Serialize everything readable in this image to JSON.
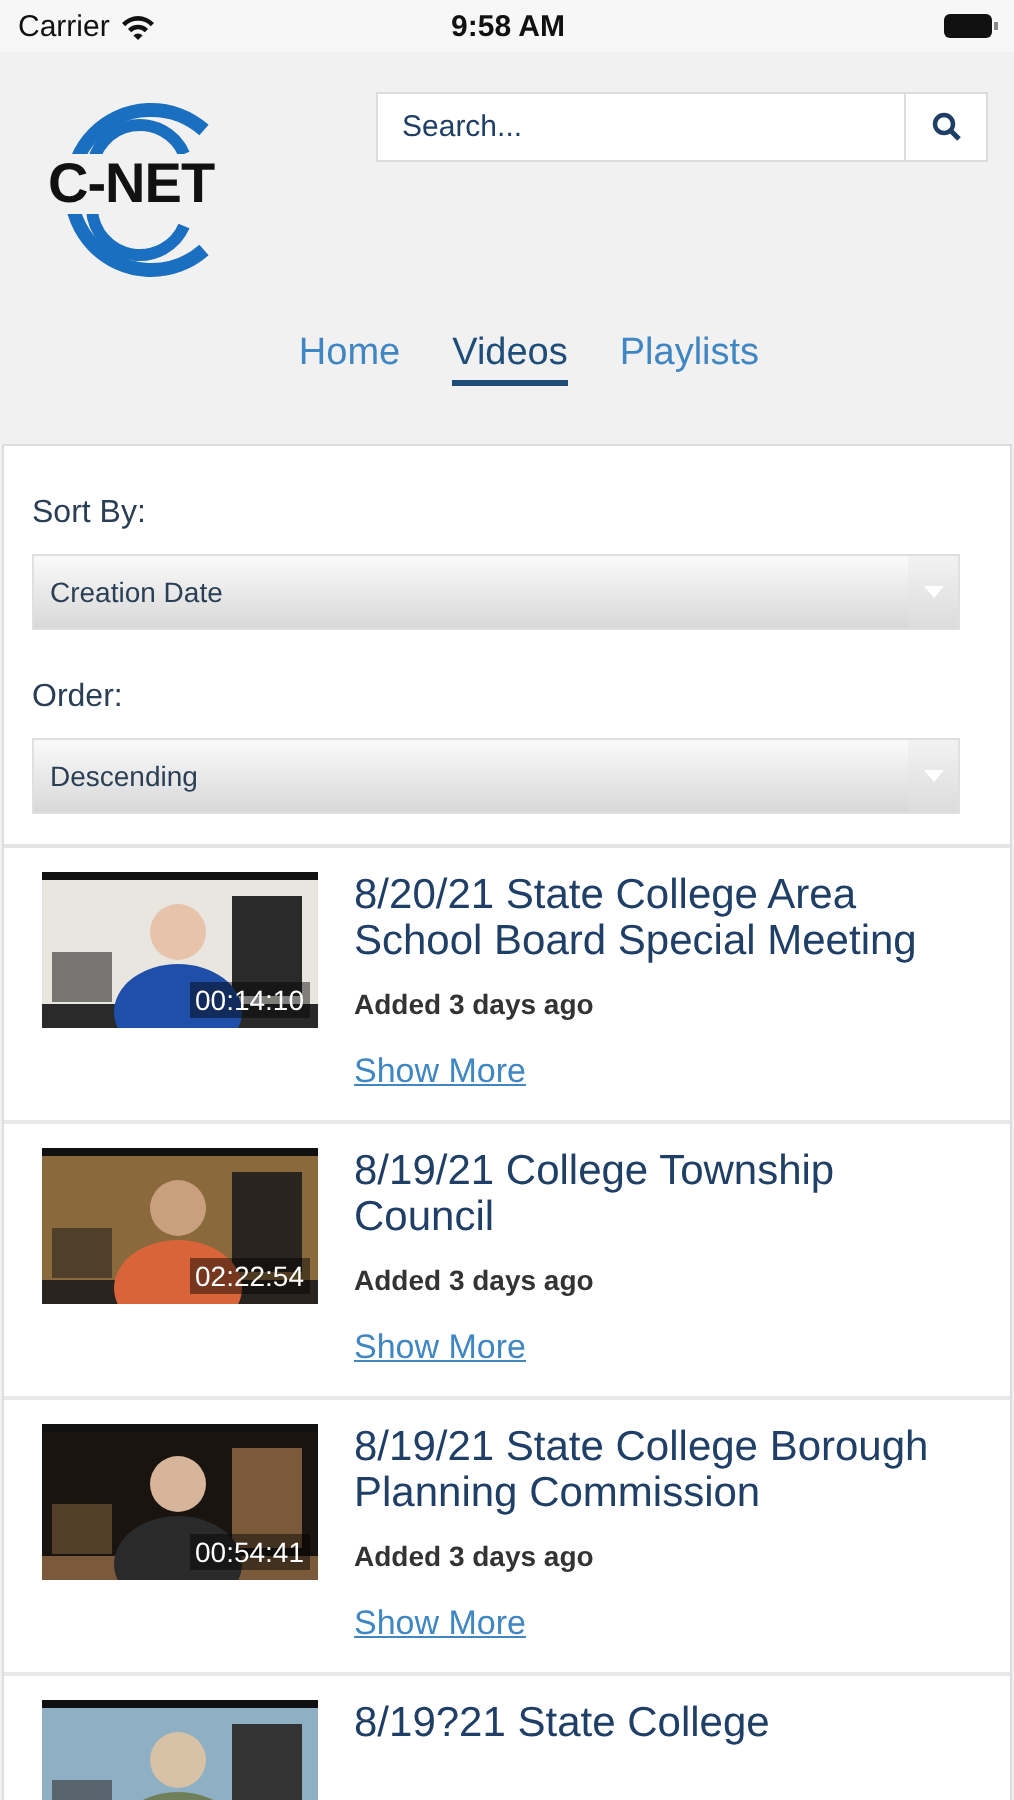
{
  "status_bar": {
    "carrier": "Carrier",
    "time": "9:58 AM"
  },
  "header": {
    "logo_text": "C-NET",
    "search": {
      "placeholder": "Search..."
    }
  },
  "tabs": [
    {
      "label": "Home",
      "selected": false
    },
    {
      "label": "Videos",
      "selected": true
    },
    {
      "label": "Playlists",
      "selected": false
    }
  ],
  "filters": [
    {
      "label": "Sort By:",
      "value": "Creation Date"
    },
    {
      "label": "Order:",
      "value": "Descending"
    }
  ],
  "videos": [
    {
      "title": "8/20/21 State College Area School Board Special Meeting",
      "duration": "00:14:10",
      "added": "Added 3 days ago",
      "link": "Show More"
    },
    {
      "title": "8/19/21 College Township Council",
      "duration": "02:22:54",
      "added": "Added 3 days ago",
      "link": "Show More"
    },
    {
      "title": "8/19/21 State College Borough Planning Commission",
      "duration": "00:54:41",
      "added": "Added 3 days ago",
      "link": "Show More"
    },
    {
      "title": "8/19?21 State College"
    }
  ]
}
